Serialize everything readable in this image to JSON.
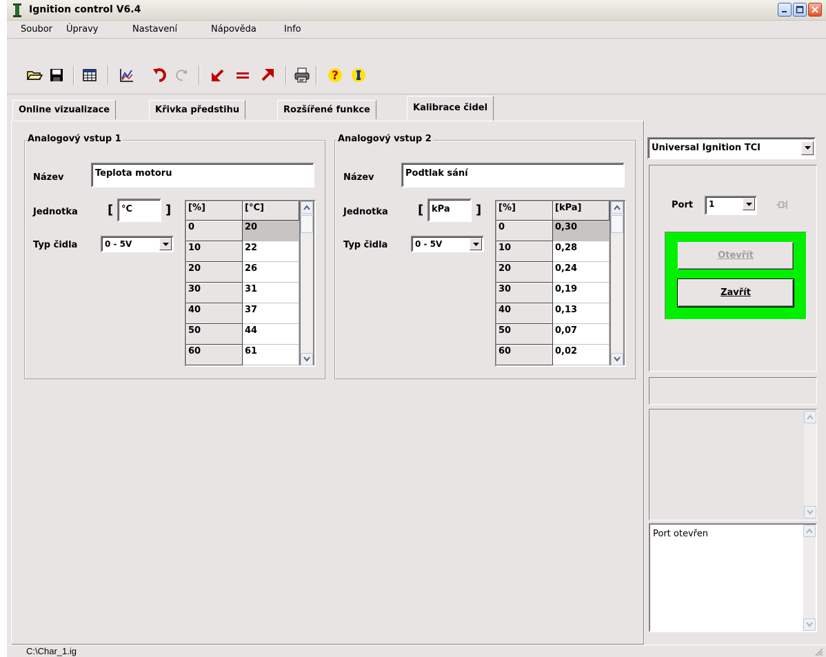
{
  "window": {
    "title": "Ignition control V6.4"
  },
  "menu": [
    {
      "label": "Soubor"
    },
    {
      "label": "Úpravy"
    },
    {
      "label": "Nastavení"
    },
    {
      "label": "Nápověda"
    },
    {
      "label": "Info"
    }
  ],
  "toolbar": {
    "icons": [
      "open-folder-icon",
      "save-icon",
      "table-icon",
      "chart-icon",
      "undo-icon",
      "redo-icon",
      "arrow-down-left-icon",
      "equals-icon",
      "arrow-up-right-icon",
      "print-icon",
      "help-icon",
      "info-icon"
    ]
  },
  "tabs": [
    {
      "label": "Online vizualizace"
    },
    {
      "label": "Křivka předstihu"
    },
    {
      "label": "Rozšířené funkce"
    },
    {
      "label": "Kalibrace čidel"
    }
  ],
  "input1": {
    "title": "Analogový vstup 1",
    "name_label": "Název",
    "name_value": "Teplota motoru",
    "unit_label": "Jednotka",
    "unit_value": "°C",
    "bracket_open": "[",
    "bracket_close": "]",
    "type_label": "Typ čidla",
    "type_value": "0 - 5V",
    "grid_header_pct": "[%]",
    "grid_header_unit": "[°C]",
    "rows": [
      {
        "pct": "0",
        "val": "20"
      },
      {
        "pct": "10",
        "val": "22"
      },
      {
        "pct": "20",
        "val": "26"
      },
      {
        "pct": "30",
        "val": "31"
      },
      {
        "pct": "40",
        "val": "37"
      },
      {
        "pct": "50",
        "val": "44"
      },
      {
        "pct": "60",
        "val": "61"
      }
    ]
  },
  "input2": {
    "title": "Analogový vstup 2",
    "name_label": "Název",
    "name_value": "Podtlak sání",
    "unit_label": "Jednotka",
    "unit_value": "kPa",
    "bracket_open": "[",
    "bracket_close": "]",
    "type_label": "Typ čidla",
    "type_value": "0 - 5V",
    "grid_header_pct": "[%]",
    "grid_header_unit": "[kPa]",
    "rows": [
      {
        "pct": "0",
        "val": "0,30"
      },
      {
        "pct": "10",
        "val": "0,28"
      },
      {
        "pct": "20",
        "val": "0,24"
      },
      {
        "pct": "30",
        "val": "0,19"
      },
      {
        "pct": "40",
        "val": "0,13"
      },
      {
        "pct": "50",
        "val": "0,07"
      },
      {
        "pct": "60",
        "val": "0,02"
      }
    ]
  },
  "right": {
    "device_value": "Universal Ignition TCI",
    "port_label": "Port",
    "port_value": "1",
    "open_button": "Otevřít",
    "close_button": "Zavřít",
    "status_panel_color": "#00f000",
    "log_text": "Port otevřen"
  },
  "statusbar": {
    "path": "C:\\Char_1.ig"
  }
}
